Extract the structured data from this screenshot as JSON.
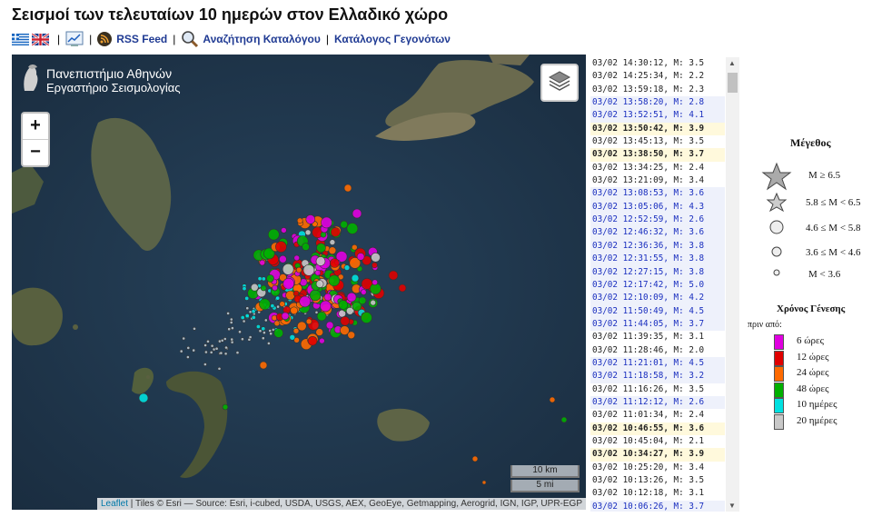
{
  "page_title": "Σεισμοί των τελευταίων 10 ημερών στον Ελλαδικό χώρο",
  "toolbar": {
    "rss_label": "RSS Feed",
    "catalog_search_label": "Αναζήτηση Καταλόγου",
    "event_catalog_label": "Κατάλογος Γεγονότων",
    "separator": "|"
  },
  "map": {
    "brand_line1": "Πανεπιστήμιο Αθηνών",
    "brand_line2": "Εργαστήριο Σεισμολογίας",
    "zoom_in": "+",
    "zoom_out": "−",
    "scale_km": "10 km",
    "scale_mi": "5 mi",
    "attribution_leaflet": "Leaflet",
    "attribution_rest": " | Tiles © Esri — Source: Esri, i-cubed, USDA, USGS, AEX, GeoEye, Getmapping, Aerogrid, IGN, IGP, UPR-EGP"
  },
  "events": [
    {
      "text": "03/02 14:30:12,  M: 3.5",
      "style": "plain"
    },
    {
      "text": "03/02 14:25:34,  M: 2.2",
      "style": "plain"
    },
    {
      "text": "03/02 13:59:18,  M: 2.3",
      "style": "plain"
    },
    {
      "text": "03/02 13:58:20,  M: 2.8",
      "style": "blue"
    },
    {
      "text": "03/02 13:52:51,  M: 4.1",
      "style": "blue"
    },
    {
      "text": "03/02 13:50:42,  M: 3.9",
      "style": "yel"
    },
    {
      "text": "03/02 13:45:13,  M: 3.5",
      "style": "plain"
    },
    {
      "text": "03/02 13:38:50,  M: 3.7",
      "style": "yel"
    },
    {
      "text": "03/02 13:34:25,  M: 2.4",
      "style": "plain"
    },
    {
      "text": "03/02 13:21:09,  M: 3.4",
      "style": "plain"
    },
    {
      "text": "03/02 13:08:53,  M: 3.6",
      "style": "blue"
    },
    {
      "text": "03/02 13:05:06,  M: 4.3",
      "style": "blue"
    },
    {
      "text": "03/02 12:52:59,  M: 2.6",
      "style": "blue"
    },
    {
      "text": "03/02 12:46:32,  M: 3.6",
      "style": "blue"
    },
    {
      "text": "03/02 12:36:36,  M: 3.8",
      "style": "blue"
    },
    {
      "text": "03/02 12:31:55,  M: 3.8",
      "style": "blue"
    },
    {
      "text": "03/02 12:27:15,  M: 3.8",
      "style": "blue"
    },
    {
      "text": "03/02 12:17:42,  M: 5.0",
      "style": "blue"
    },
    {
      "text": "03/02 12:10:09,  M: 4.2",
      "style": "blue"
    },
    {
      "text": "03/02 11:50:49,  M: 4.5",
      "style": "blue"
    },
    {
      "text": "03/02 11:44:05,  M: 3.7",
      "style": "blue"
    },
    {
      "text": "03/02 11:39:35,  M: 3.1",
      "style": "plain"
    },
    {
      "text": "03/02 11:28:46,  M: 2.0",
      "style": "plain"
    },
    {
      "text": "03/02 11:21:01,  M: 4.5",
      "style": "blue"
    },
    {
      "text": "03/02 11:18:58,  M: 3.2",
      "style": "blue"
    },
    {
      "text": "03/02 11:16:26,  M: 3.5",
      "style": "plain"
    },
    {
      "text": "03/02 11:12:12,  M: 2.6",
      "style": "blue"
    },
    {
      "text": "03/02 11:01:34,  M: 2.4",
      "style": "plain"
    },
    {
      "text": "03/02 10:46:55,  M: 3.6",
      "style": "yel"
    },
    {
      "text": "03/02 10:45:04,  M: 2.1",
      "style": "plain"
    },
    {
      "text": "03/02 10:34:27,  M: 3.9",
      "style": "yel"
    },
    {
      "text": "03/02 10:25:20,  M: 3.4",
      "style": "plain"
    },
    {
      "text": "03/02 10:13:26,  M: 3.5",
      "style": "plain"
    },
    {
      "text": "03/02 10:12:18,  M: 3.1",
      "style": "plain"
    },
    {
      "text": "03/02 10:06:26,  M: 3.7",
      "style": "blue"
    }
  ],
  "legend": {
    "magnitude_title": "Μέγεθος",
    "magnitude_items": [
      "M ≥ 6.5",
      "5.8 ≤  M < 6.5",
      "4.6 ≤  M < 5.8",
      "3.6 ≤  M < 4.6",
      "M < 3.6"
    ],
    "time_title": "Χρόνος Γένεσης",
    "time_subtitle": "πριν από:",
    "time_items": [
      {
        "label": "6 ώρες",
        "color": "#e000e0"
      },
      {
        "label": "12 ώρες",
        "color": "#e00000"
      },
      {
        "label": "24 ώρες",
        "color": "#ff6a00"
      },
      {
        "label": "48 ώρες",
        "color": "#00b000"
      },
      {
        "label": "10 ημέρες",
        "color": "#00e0e0"
      },
      {
        "label": "20 ημέρες",
        "color": "#c8c8c8"
      }
    ]
  }
}
